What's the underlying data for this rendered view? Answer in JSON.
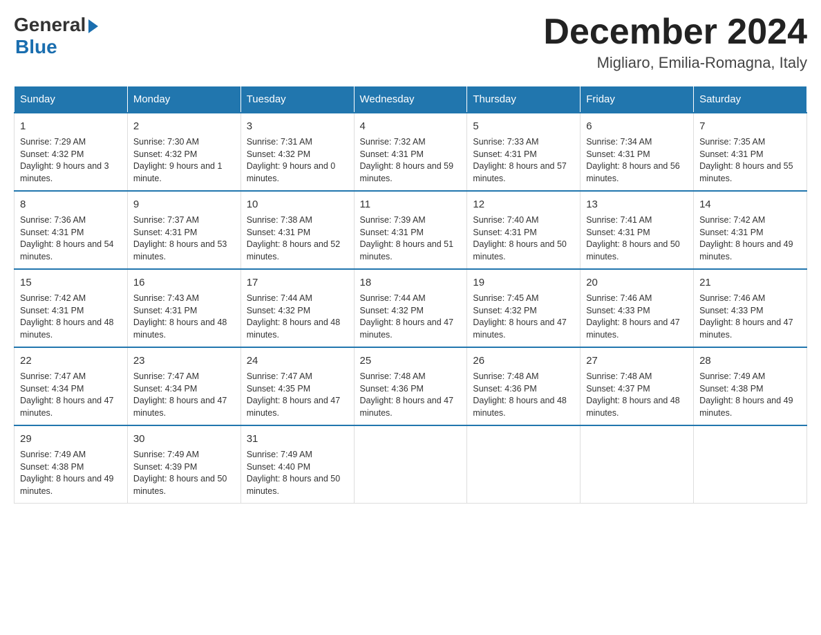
{
  "logo": {
    "general": "General",
    "blue": "Blue"
  },
  "title": "December 2024",
  "location": "Migliaro, Emilia-Romagna, Italy",
  "days_of_week": [
    "Sunday",
    "Monday",
    "Tuesday",
    "Wednesday",
    "Thursday",
    "Friday",
    "Saturday"
  ],
  "weeks": [
    [
      {
        "day": "1",
        "sunrise": "7:29 AM",
        "sunset": "4:32 PM",
        "daylight": "9 hours and 3 minutes."
      },
      {
        "day": "2",
        "sunrise": "7:30 AM",
        "sunset": "4:32 PM",
        "daylight": "9 hours and 1 minute."
      },
      {
        "day": "3",
        "sunrise": "7:31 AM",
        "sunset": "4:32 PM",
        "daylight": "9 hours and 0 minutes."
      },
      {
        "day": "4",
        "sunrise": "7:32 AM",
        "sunset": "4:31 PM",
        "daylight": "8 hours and 59 minutes."
      },
      {
        "day": "5",
        "sunrise": "7:33 AM",
        "sunset": "4:31 PM",
        "daylight": "8 hours and 57 minutes."
      },
      {
        "day": "6",
        "sunrise": "7:34 AM",
        "sunset": "4:31 PM",
        "daylight": "8 hours and 56 minutes."
      },
      {
        "day": "7",
        "sunrise": "7:35 AM",
        "sunset": "4:31 PM",
        "daylight": "8 hours and 55 minutes."
      }
    ],
    [
      {
        "day": "8",
        "sunrise": "7:36 AM",
        "sunset": "4:31 PM",
        "daylight": "8 hours and 54 minutes."
      },
      {
        "day": "9",
        "sunrise": "7:37 AM",
        "sunset": "4:31 PM",
        "daylight": "8 hours and 53 minutes."
      },
      {
        "day": "10",
        "sunrise": "7:38 AM",
        "sunset": "4:31 PM",
        "daylight": "8 hours and 52 minutes."
      },
      {
        "day": "11",
        "sunrise": "7:39 AM",
        "sunset": "4:31 PM",
        "daylight": "8 hours and 51 minutes."
      },
      {
        "day": "12",
        "sunrise": "7:40 AM",
        "sunset": "4:31 PM",
        "daylight": "8 hours and 50 minutes."
      },
      {
        "day": "13",
        "sunrise": "7:41 AM",
        "sunset": "4:31 PM",
        "daylight": "8 hours and 50 minutes."
      },
      {
        "day": "14",
        "sunrise": "7:42 AM",
        "sunset": "4:31 PM",
        "daylight": "8 hours and 49 minutes."
      }
    ],
    [
      {
        "day": "15",
        "sunrise": "7:42 AM",
        "sunset": "4:31 PM",
        "daylight": "8 hours and 48 minutes."
      },
      {
        "day": "16",
        "sunrise": "7:43 AM",
        "sunset": "4:31 PM",
        "daylight": "8 hours and 48 minutes."
      },
      {
        "day": "17",
        "sunrise": "7:44 AM",
        "sunset": "4:32 PM",
        "daylight": "8 hours and 48 minutes."
      },
      {
        "day": "18",
        "sunrise": "7:44 AM",
        "sunset": "4:32 PM",
        "daylight": "8 hours and 47 minutes."
      },
      {
        "day": "19",
        "sunrise": "7:45 AM",
        "sunset": "4:32 PM",
        "daylight": "8 hours and 47 minutes."
      },
      {
        "day": "20",
        "sunrise": "7:46 AM",
        "sunset": "4:33 PM",
        "daylight": "8 hours and 47 minutes."
      },
      {
        "day": "21",
        "sunrise": "7:46 AM",
        "sunset": "4:33 PM",
        "daylight": "8 hours and 47 minutes."
      }
    ],
    [
      {
        "day": "22",
        "sunrise": "7:47 AM",
        "sunset": "4:34 PM",
        "daylight": "8 hours and 47 minutes."
      },
      {
        "day": "23",
        "sunrise": "7:47 AM",
        "sunset": "4:34 PM",
        "daylight": "8 hours and 47 minutes."
      },
      {
        "day": "24",
        "sunrise": "7:47 AM",
        "sunset": "4:35 PM",
        "daylight": "8 hours and 47 minutes."
      },
      {
        "day": "25",
        "sunrise": "7:48 AM",
        "sunset": "4:36 PM",
        "daylight": "8 hours and 47 minutes."
      },
      {
        "day": "26",
        "sunrise": "7:48 AM",
        "sunset": "4:36 PM",
        "daylight": "8 hours and 48 minutes."
      },
      {
        "day": "27",
        "sunrise": "7:48 AM",
        "sunset": "4:37 PM",
        "daylight": "8 hours and 48 minutes."
      },
      {
        "day": "28",
        "sunrise": "7:49 AM",
        "sunset": "4:38 PM",
        "daylight": "8 hours and 49 minutes."
      }
    ],
    [
      {
        "day": "29",
        "sunrise": "7:49 AM",
        "sunset": "4:38 PM",
        "daylight": "8 hours and 49 minutes."
      },
      {
        "day": "30",
        "sunrise": "7:49 AM",
        "sunset": "4:39 PM",
        "daylight": "8 hours and 50 minutes."
      },
      {
        "day": "31",
        "sunrise": "7:49 AM",
        "sunset": "4:40 PM",
        "daylight": "8 hours and 50 minutes."
      },
      null,
      null,
      null,
      null
    ]
  ]
}
